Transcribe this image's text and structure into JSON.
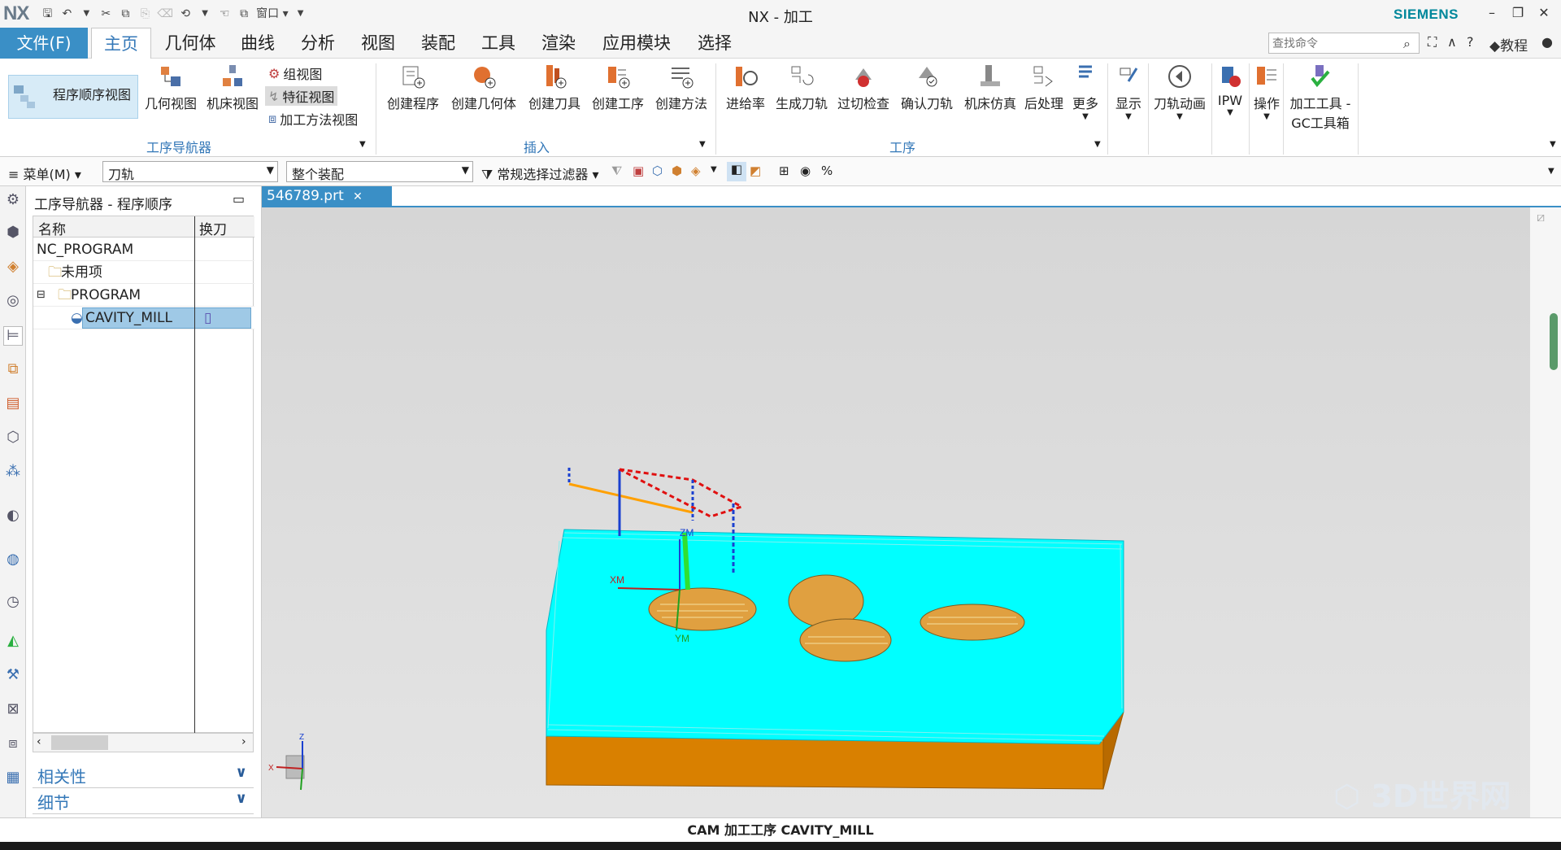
{
  "app": {
    "logo": "NX",
    "title": "NX - 加工",
    "brand": "SIEMENS"
  },
  "qat": {
    "window_label": "窗口"
  },
  "window_controls": {
    "minimize": "–",
    "restore": "❐",
    "close": "✕"
  },
  "menu": {
    "file": "文件(F)",
    "tabs": [
      "主页",
      "几何体",
      "曲线",
      "分析",
      "视图",
      "装配",
      "工具",
      "渲染",
      "应用模块",
      "选择"
    ],
    "active_tab": "主页",
    "search_placeholder": "查找命令",
    "tutorial": "教程"
  },
  "ribbon": {
    "nav_group": {
      "label": "工序导航器",
      "program_order_view": "程序顺序视图",
      "geometry_view": "几何视图",
      "machine_view": "机床视图",
      "group_view": "组视图",
      "feature_view": "特征视图",
      "method_view": "加工方法视图"
    },
    "insert_group": {
      "label": "插入",
      "items": [
        "创建程序",
        "创建几何体",
        "创建刀具",
        "创建工序",
        "创建方法"
      ]
    },
    "operation_group": {
      "label": "工序",
      "items": [
        "进给率",
        "生成刀轨",
        "过切检查",
        "确认刀轨",
        "机床仿真",
        "后处理",
        "更多"
      ]
    },
    "extra": {
      "display": "显示",
      "toolpath_anim": "刀轨动画",
      "ipw": "IPW",
      "operate": "操作",
      "gc_line1": "加工工具 -",
      "gc_line2": "GC工具箱"
    }
  },
  "toolbar": {
    "menu": "菜单(M)",
    "filter_type": "刀轨",
    "scope": "整个装配",
    "selection_filter": "常规选择过滤器"
  },
  "navigator": {
    "title": "工序导航器 - 程序顺序",
    "col_name": "名称",
    "col_toolchange": "换刀",
    "rows": [
      "NC_PROGRAM",
      "未用项",
      "PROGRAM",
      "CAVITY_MILL"
    ],
    "accordion": [
      "相关性",
      "细节"
    ]
  },
  "document": {
    "tab": "546789.prt"
  },
  "triad": {
    "zm": "ZM",
    "xm": "XM",
    "ym": "YM",
    "x": "X",
    "z": "Z"
  },
  "status": {
    "text": "CAM 加工工序 CAVITY_MILL"
  },
  "watermark": "3D世界网",
  "colors": {
    "accent": "#3a8fc6",
    "stock": "#00ffff",
    "part": "#d98000",
    "brand": "#00879b"
  }
}
